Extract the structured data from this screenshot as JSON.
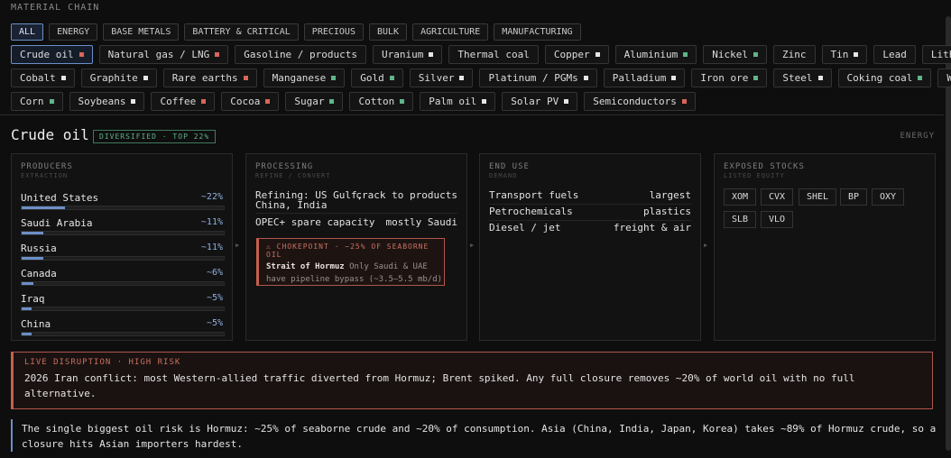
{
  "section_title": "MATERIAL CHAIN",
  "categories": [
    "ALL",
    "ENERGY",
    "BASE METALS",
    "BATTERY & CRITICAL",
    "PRECIOUS",
    "BULK",
    "AGRICULTURE",
    "MANUFACTURING"
  ],
  "active_category": "ALL",
  "commodity_rows": [
    [
      {
        "label": "Crude oil",
        "color": "#d9665a"
      },
      {
        "label": "Natural gas / LNG",
        "color": "#d9665a"
      },
      {
        "label": "Gasoline / products",
        "color": ""
      },
      {
        "label": "Uranium",
        "color": "#e6e6e6"
      },
      {
        "label": "Thermal coal",
        "color": ""
      },
      {
        "label": "Copper",
        "color": "#e6e6e6"
      },
      {
        "label": "Aluminium",
        "color": "#5fb58a"
      },
      {
        "label": "Nickel",
        "color": "#5fb58a"
      },
      {
        "label": "Zinc",
        "color": ""
      },
      {
        "label": "Tin",
        "color": "#e6e6e6"
      },
      {
        "label": "Lead",
        "color": ""
      },
      {
        "label": "Lithium",
        "color": "#e6e6e6"
      }
    ],
    [
      {
        "label": "Cobalt",
        "color": "#e6e6e6"
      },
      {
        "label": "Graphite",
        "color": "#e6e6e6"
      },
      {
        "label": "Rare earths",
        "color": "#d9665a"
      },
      {
        "label": "Manganese",
        "color": "#5fb58a"
      },
      {
        "label": "Gold",
        "color": "#5fb58a"
      },
      {
        "label": "Silver",
        "color": "#e6e6e6"
      },
      {
        "label": "Platinum / PGMs",
        "color": "#e6e6e6"
      },
      {
        "label": "Palladium",
        "color": "#e6e6e6"
      },
      {
        "label": "Iron ore",
        "color": "#5fb58a"
      },
      {
        "label": "Steel",
        "color": "#e6e6e6"
      },
      {
        "label": "Coking coal",
        "color": "#5fb58a"
      },
      {
        "label": "Wheat",
        "color": "#e6e6e6"
      }
    ],
    [
      {
        "label": "Corn",
        "color": "#5fb58a"
      },
      {
        "label": "Soybeans",
        "color": "#e6e6e6"
      },
      {
        "label": "Coffee",
        "color": "#d9665a"
      },
      {
        "label": "Cocoa",
        "color": "#d9665a"
      },
      {
        "label": "Sugar",
        "color": "#5fb58a"
      },
      {
        "label": "Cotton",
        "color": "#5fb58a"
      },
      {
        "label": "Palm oil",
        "color": "#e6e6e6"
      },
      {
        "label": "Solar PV",
        "color": "#e6e6e6"
      },
      {
        "label": "Semiconductors",
        "color": "#d9665a"
      }
    ]
  ],
  "active_commodity": "Crude oil",
  "detail": {
    "title": "Crude oil",
    "badge": "DIVERSIFIED · TOP 22%",
    "sector": "ENERGY"
  },
  "producers": {
    "header": "PRODUCERS",
    "sub": "EXTRACTION",
    "items": [
      {
        "name": "United States",
        "pct_label": "~22%",
        "share": 0.22
      },
      {
        "name": "Saudi Arabia",
        "pct_label": "~11%",
        "share": 0.11
      },
      {
        "name": "Russia",
        "pct_label": "~11%",
        "share": 0.11
      },
      {
        "name": "Canada",
        "pct_label": "~6%",
        "share": 0.06
      },
      {
        "name": "Iraq",
        "pct_label": "~5%",
        "share": 0.05
      },
      {
        "name": "China",
        "pct_label": "~5%",
        "share": 0.05
      }
    ]
  },
  "processing": {
    "header": "PROCESSING",
    "sub": "REFINE / CONVERT",
    "items": [
      {
        "key": "Refining: US Gulf, China, India",
        "value": "crack to products"
      },
      {
        "key": "OPEC+ spare capacity",
        "value": "mostly Saudi"
      }
    ],
    "chokepoint": {
      "header": "⚠ CHOKEPOINT · ~25% OF SEABORNE OIL",
      "name": "Strait of Hormuz",
      "text": " Only Saudi & UAE have pipeline bypass (~3.5–5.5 mb/d)"
    }
  },
  "end_use": {
    "header": "END USE",
    "sub": "DEMAND",
    "items": [
      {
        "key": "Transport fuels",
        "value": "largest"
      },
      {
        "key": "Petrochemicals",
        "value": "plastics"
      },
      {
        "key": "Diesel / jet",
        "value": "freight & air"
      }
    ]
  },
  "stocks": {
    "header": "EXPOSED STOCKS",
    "sub": "LISTED EQUITY",
    "tickers": [
      "XOM",
      "CVX",
      "SHEL",
      "BP",
      "OXY",
      "SLB",
      "VLO"
    ]
  },
  "disruption": {
    "header": "LIVE DISRUPTION · HIGH RISK",
    "text": "2026 Iran conflict: most Western-allied traffic diverted from Hormuz; Brent spiked. Any full closure removes ~20% of world oil with no full alternative."
  },
  "note": "The single biggest oil risk is Hormuz: ~25% of seaborne crude and ~20% of consumption. Asia (China, India, Japan, Korea) takes ~89% of Hormuz crude, so a closure hits Asian importers hardest."
}
